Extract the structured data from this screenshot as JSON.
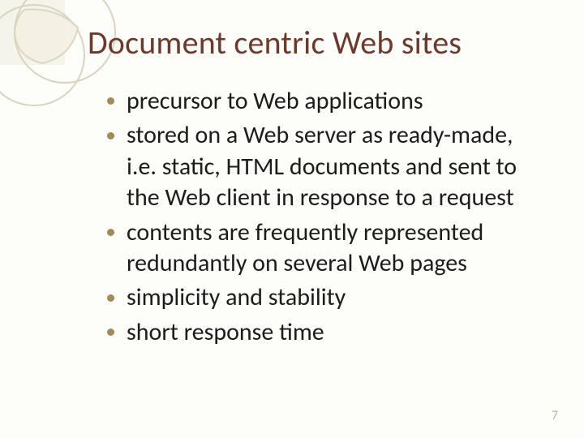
{
  "slide": {
    "title": "Document centric Web sites",
    "bullets": [
      "precursor to Web applications",
      "stored on a Web server as ready-made, i.e. static, HTML documents and sent to the Web client in response to a request",
      "contents are frequently represented redundantly on several Web pages",
      "simplicity and stability",
      "short response time"
    ],
    "page_number": "7"
  },
  "theme": {
    "accent_color": "#6b3a2c",
    "bullet_color": "#a08b5b",
    "decor_stroke": "#d9d4c0",
    "decor_fill": "#efecdc"
  }
}
